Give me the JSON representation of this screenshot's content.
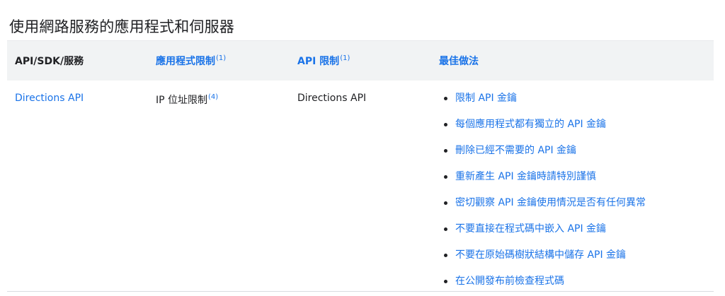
{
  "page": {
    "title": "使用網路服務的應用程式和伺服器"
  },
  "table": {
    "headers": {
      "api": "API/SDK/服務",
      "app_restriction": "應用程式限制",
      "app_restriction_note": "(1)",
      "api_restriction": "API 限制",
      "api_restriction_note": "(1)",
      "best_practices": "最佳做法"
    },
    "row": {
      "api": "Directions API",
      "app_restriction": "IP 位址限制",
      "app_restriction_note": "(4)",
      "api_restriction": "Directions API",
      "best_practices": [
        "限制 API 金鑰",
        "每個應用程式都有獨立的 API 金鑰",
        "刪除已經不需要的 API 金鑰",
        "重新產生 API 金鑰時請特別謹慎",
        "密切觀察 API 金鑰使用情況是否有任何異常",
        "不要直接在程式碼中嵌入 API 金鑰",
        "不要在原始碼樹狀結構中儲存 API 金鑰",
        "在公開發布前檢查程式碼"
      ]
    }
  },
  "colors": {
    "link": "#1a73e8",
    "text": "#202124",
    "header_bg": "#f1f3f4"
  }
}
